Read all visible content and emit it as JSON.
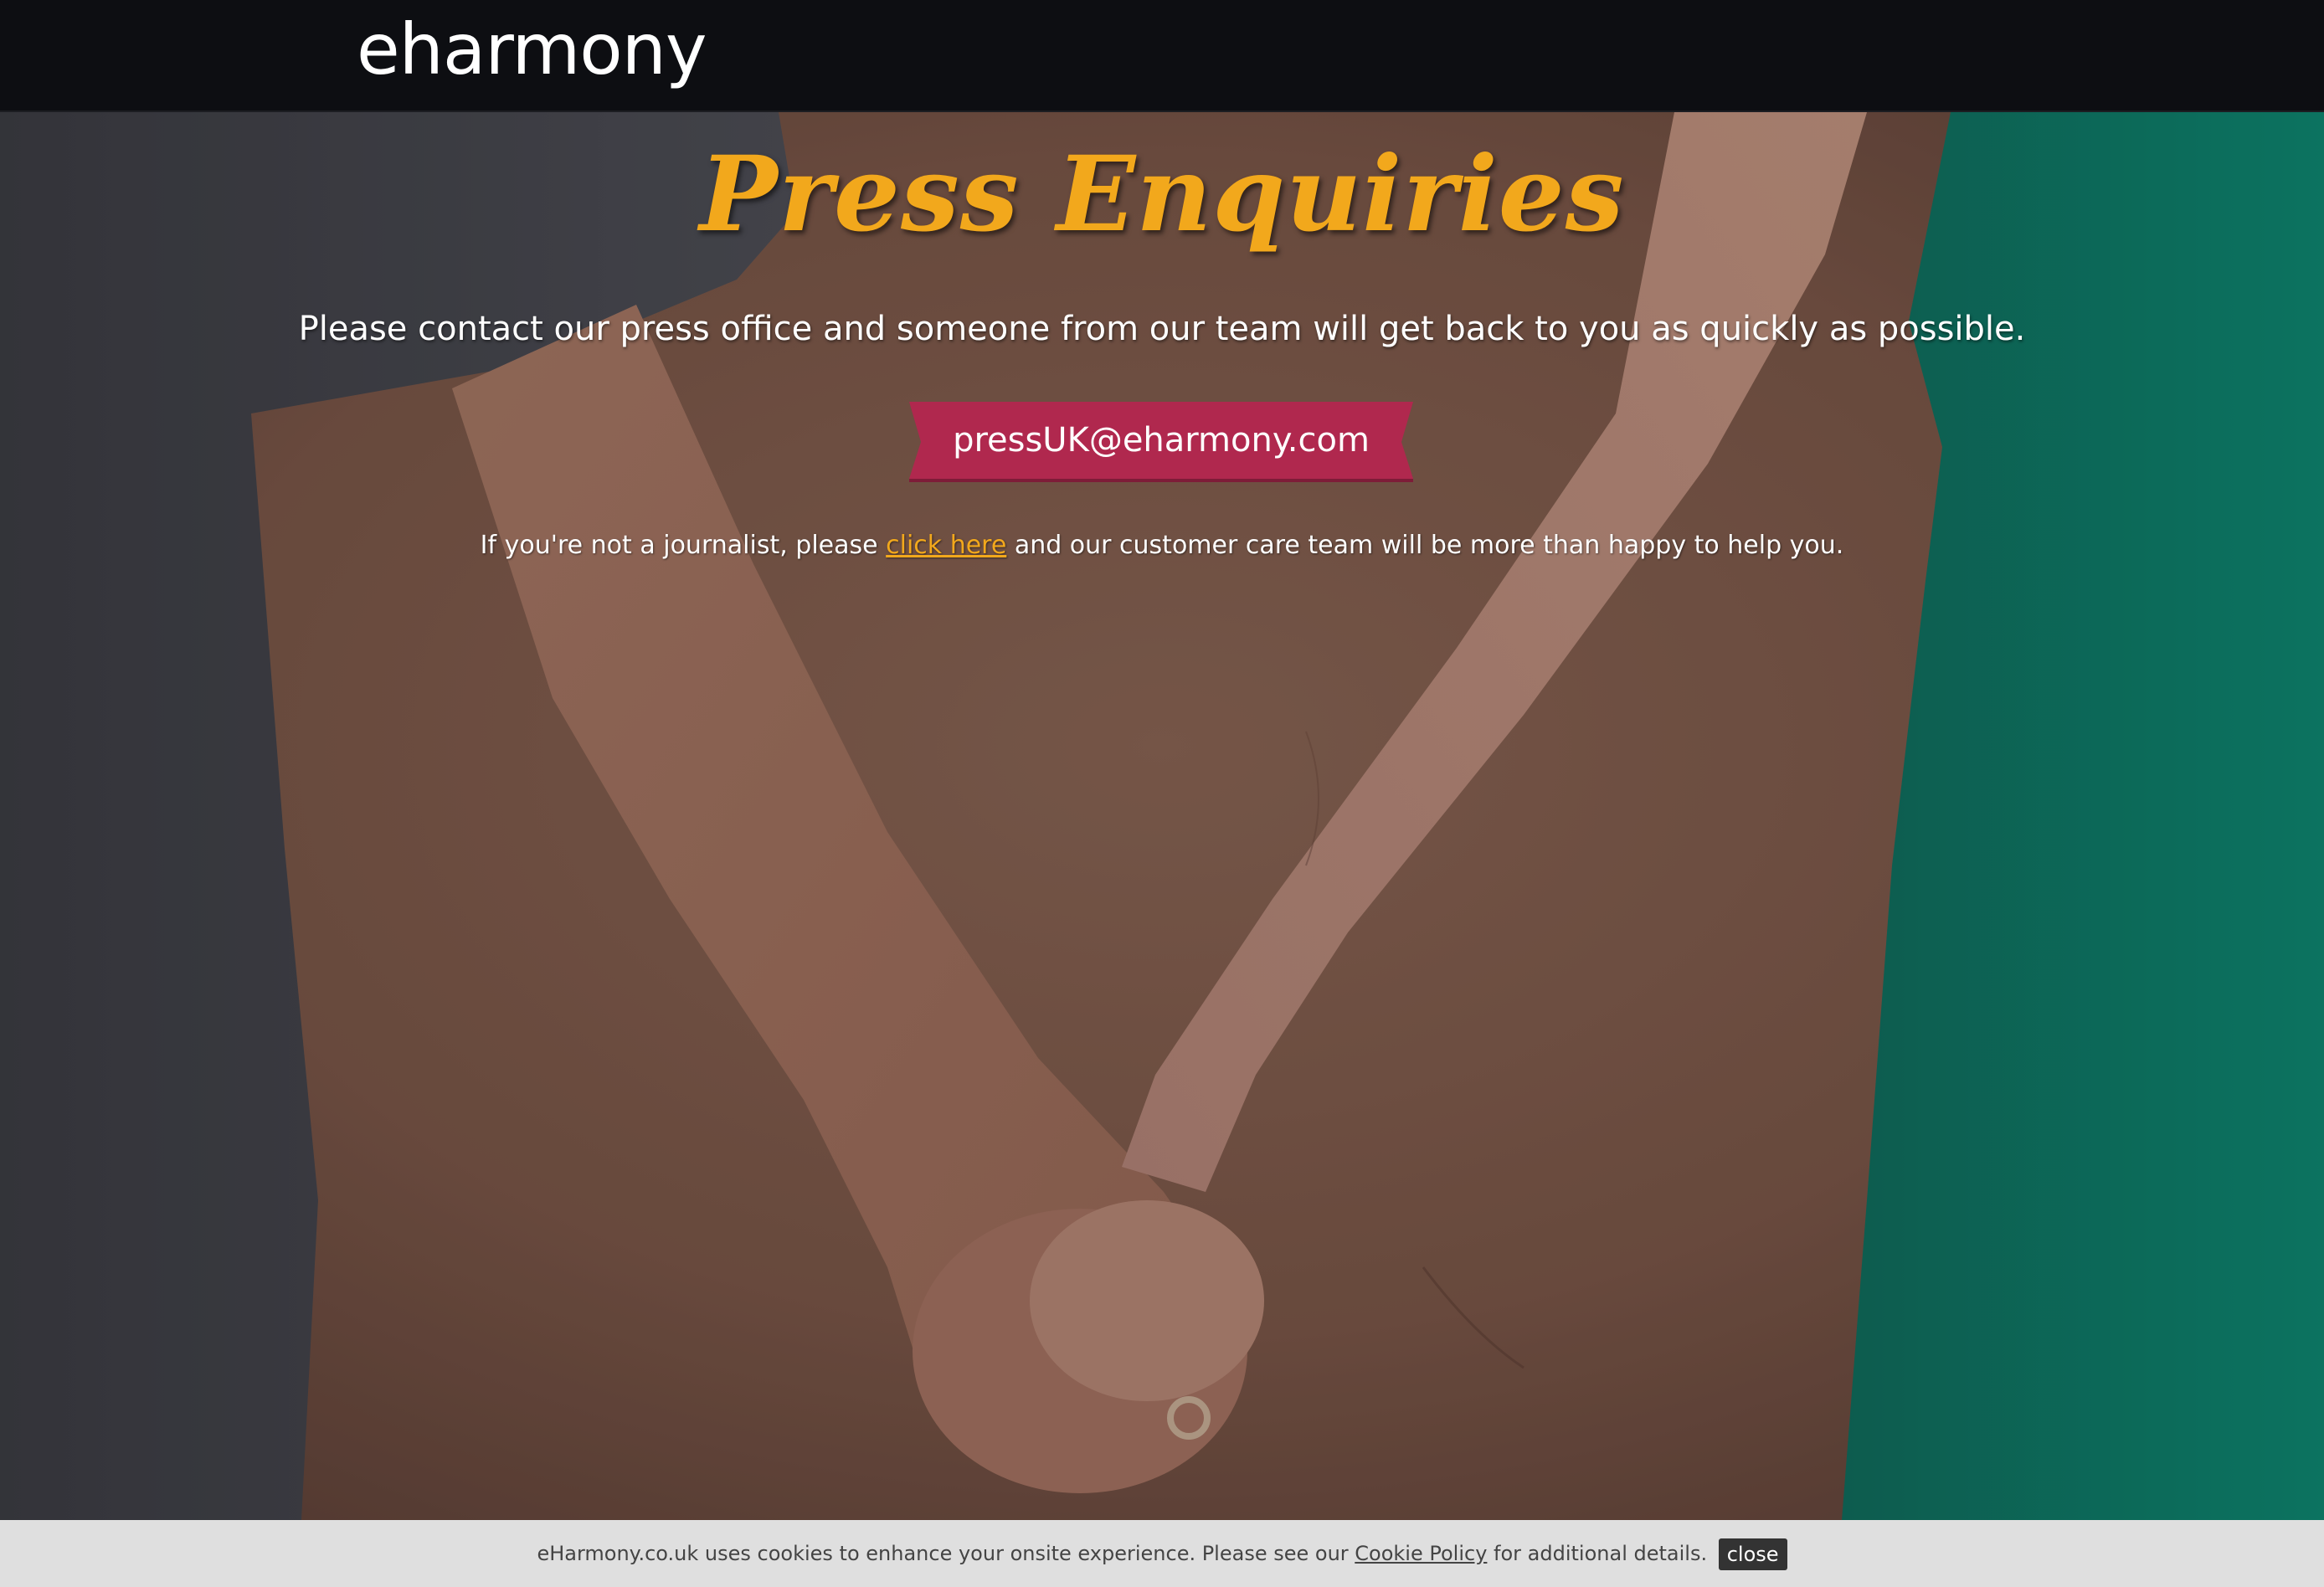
{
  "header": {
    "logo_text": "eharmony"
  },
  "main": {
    "headline": "Press Enquiries",
    "subhead": "Please contact our press office and someone from our team will get back to you as quickly as possible.",
    "email_button": "pressUK@eharmony.com",
    "note_before": "If you're not a journalist, please ",
    "note_link": "click here",
    "note_after": " and our customer care team will be more than happy to help you."
  },
  "cookie_bar": {
    "text_before": "eHarmony.co.uk uses cookies to enhance your onsite experience. Please see our ",
    "policy_link": "Cookie Policy",
    "text_after": " for additional details.",
    "close_label": "close"
  },
  "colors": {
    "header_bg": "#0d0e12",
    "headline": "#f2a81c",
    "ribbon": "#b0284e",
    "link": "#f2a81c",
    "cookie_bg": "#dfdfdf",
    "close_bg": "#333333"
  }
}
